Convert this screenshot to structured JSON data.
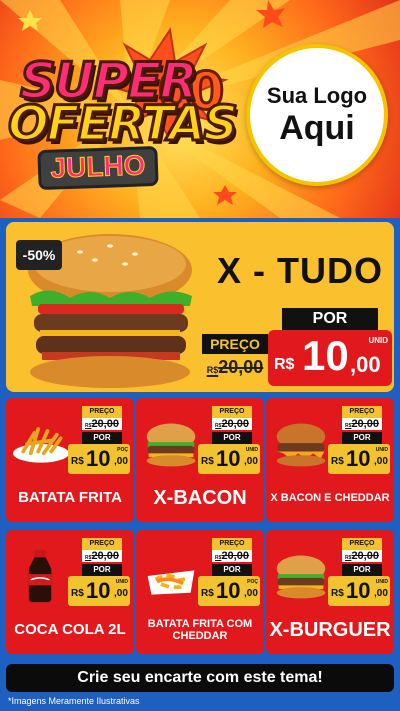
{
  "header": {
    "title_line1": "SUPER",
    "title_line2": "OFERTAS",
    "title_zeros": "00",
    "month": "JULHO",
    "logo_line1": "Sua Logo",
    "logo_line2": "Aqui"
  },
  "featured": {
    "discount": "-50%",
    "name": "X - TUDO",
    "old_label": "PREÇO",
    "old_currency": "R$",
    "old_value": "20,00",
    "new_label": "POR",
    "new_currency": "R$",
    "new_int": "10",
    "new_dec": ",00",
    "unit": "UNID"
  },
  "products": [
    {
      "name": "BATATA FRITA",
      "preco_label": "PREÇO",
      "old_currency": "R$",
      "old_value": "20,00",
      "por_label": "POR",
      "currency": "R$",
      "int": "10",
      "dec": ",00",
      "unit": "POÇ",
      "image": "fries"
    },
    {
      "name": "X-BACON",
      "preco_label": "PREÇO",
      "old_currency": "R$",
      "old_value": "20,00",
      "por_label": "POR",
      "currency": "R$",
      "int": "10",
      "dec": ",00",
      "unit": "UNID",
      "image": "burger"
    },
    {
      "name": "X BACON E CHEDDAR",
      "preco_label": "PREÇO",
      "old_currency": "R$",
      "old_value": "20,00",
      "por_label": "POR",
      "currency": "R$",
      "int": "10",
      "dec": ",00",
      "unit": "UNID",
      "image": "cheddar-burger"
    },
    {
      "name": "COCA COLA 2L",
      "preco_label": "PREÇO",
      "old_currency": "R$",
      "old_value": "20,00",
      "por_label": "POR",
      "currency": "R$",
      "int": "10",
      "dec": ",00",
      "unit": "UNID",
      "image": "soda-bottle"
    },
    {
      "name": "BATATA FRITA COM CHEDDAR",
      "preco_label": "PREÇO",
      "old_currency": "R$",
      "old_value": "20,00",
      "por_label": "POR",
      "currency": "R$",
      "int": "10",
      "dec": ",00",
      "unit": "POÇ",
      "image": "cheddar-fries"
    },
    {
      "name": "X-BURGUER",
      "preco_label": "PREÇO",
      "old_currency": "R$",
      "old_value": "20,00",
      "por_label": "POR",
      "currency": "R$",
      "int": "10",
      "dec": ",00",
      "unit": "UNID",
      "image": "burger"
    }
  ],
  "footer": {
    "cta": "Crie seu encarte com este tema!",
    "disclaimer": "*Imagens Meramente Ilustrativas"
  },
  "colors": {
    "background": "#1e5fc2",
    "featured_bg": "#fbc02d",
    "card_bg": "#e1191c",
    "price_tag": "#f3c22f"
  }
}
